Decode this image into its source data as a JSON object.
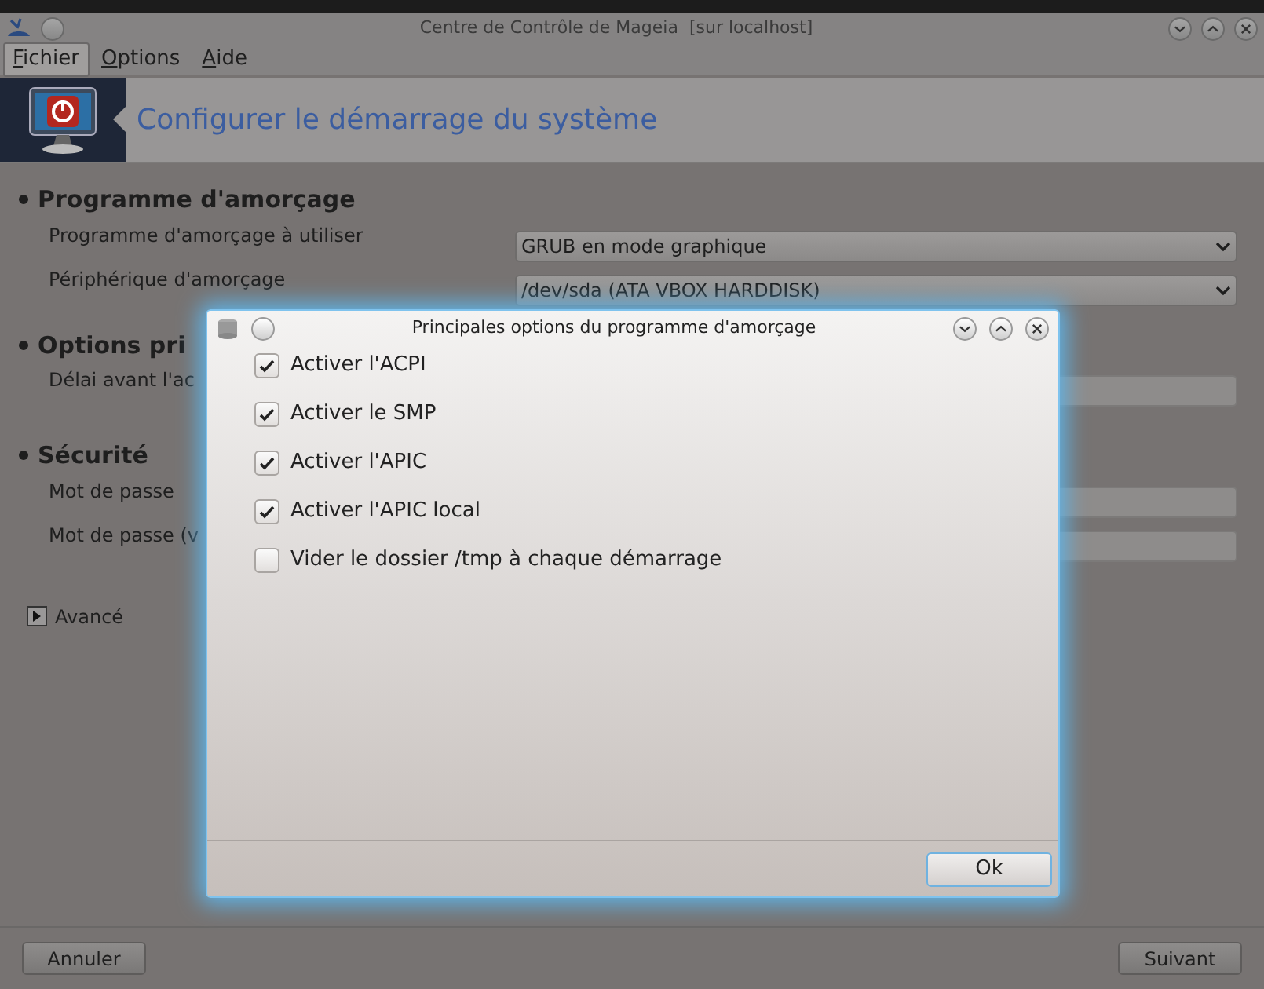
{
  "window": {
    "title": "Centre de Contrôle de Mageia  [sur localhost]"
  },
  "menu": [
    {
      "label": "Fichier",
      "selected": true
    },
    {
      "label": "Options",
      "selected": false
    },
    {
      "label": "Aide",
      "selected": false
    }
  ],
  "banner": {
    "title": "Configurer le démarrage du système"
  },
  "sections": [
    {
      "heading": "Programme d'amorçage",
      "rows": [
        {
          "label": "Programme d'amorçage à utiliser",
          "kind": "dropdown",
          "value": "GRUB en mode graphique"
        },
        {
          "label": "Périphérique d'amorçage",
          "kind": "dropdown",
          "value": "/dev/sda (ATA VBOX HARDDISK)"
        }
      ]
    },
    {
      "heading": "Options pri",
      "rows": [
        {
          "label": "Délai avant l'ac",
          "kind": "field"
        }
      ]
    },
    {
      "heading": "Sécurité",
      "rows": [
        {
          "label": "Mot de passe",
          "kind": "field"
        },
        {
          "label": "Mot de passe (v",
          "kind": "field"
        }
      ]
    }
  ],
  "advanced": {
    "label": "Avancé",
    "expanded": false
  },
  "buttons": {
    "cancel": "Annuler",
    "next": "Suivant"
  },
  "dialog": {
    "title": "Principales options du programme d'amorçage",
    "options": [
      {
        "label": "Activer l'ACPI",
        "checked": true
      },
      {
        "label": "Activer le SMP",
        "checked": true
      },
      {
        "label": "Activer l'APIC",
        "checked": true
      },
      {
        "label": "Activer l'APIC local",
        "checked": true
      },
      {
        "label": "Vider le dossier /tmp à chaque démarrage",
        "checked": false
      }
    ],
    "ok": "Ok"
  }
}
